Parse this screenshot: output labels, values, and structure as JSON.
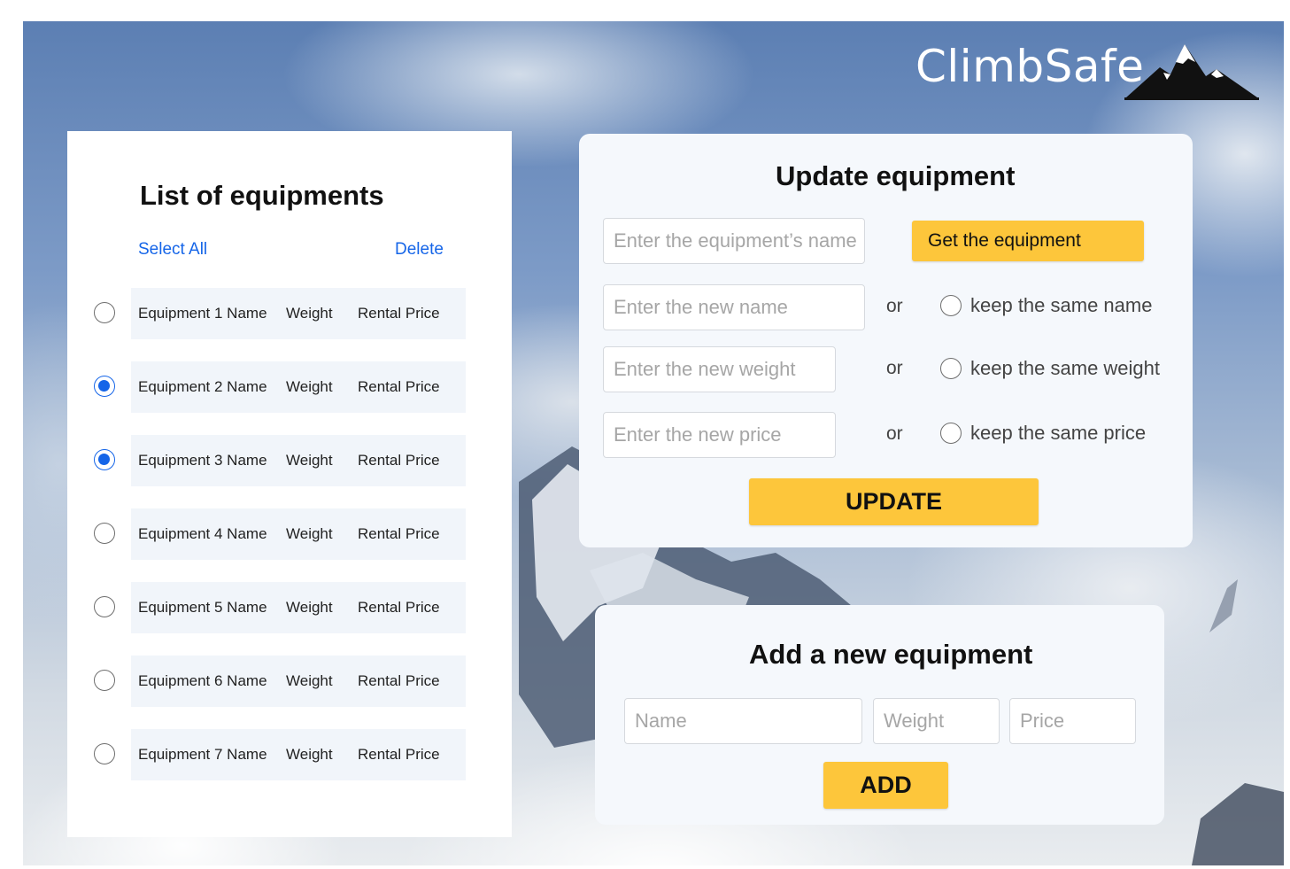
{
  "brand": {
    "name": "ClimbSafe",
    "logo_icon": "mountain-logo-icon"
  },
  "list": {
    "title": "List of equipments",
    "select_all": "Select All",
    "delete": "Delete",
    "rows": [
      {
        "name": "Equipment 1 Name",
        "weight": "Weight",
        "price": "Rental Price",
        "selected": false
      },
      {
        "name": "Equipment 2 Name",
        "weight": "Weight",
        "price": "Rental Price",
        "selected": true
      },
      {
        "name": "Equipment 3 Name",
        "weight": "Weight",
        "price": "Rental Price",
        "selected": true
      },
      {
        "name": "Equipment 4 Name",
        "weight": "Weight",
        "price": "Rental Price",
        "selected": false
      },
      {
        "name": "Equipment 5 Name",
        "weight": "Weight",
        "price": "Rental Price",
        "selected": false
      },
      {
        "name": "Equipment 6 Name",
        "weight": "Weight",
        "price": "Rental Price",
        "selected": false
      },
      {
        "name": "Equipment 7 Name",
        "weight": "Weight",
        "price": "Rental Price",
        "selected": false
      }
    ]
  },
  "update": {
    "title": "Update equipment",
    "search_placeholder": "Enter the equipment’s name",
    "get_button": "Get the equipment",
    "new_name_placeholder": "Enter the new name",
    "new_weight_placeholder": "Enter the new weight",
    "new_price_placeholder": "Enter the new price",
    "or": "or",
    "keep_name": "keep the same name",
    "keep_weight": "keep the same weight",
    "keep_price": "keep the same price",
    "update_button": "UPDATE"
  },
  "add": {
    "title": "Add a new equipment",
    "name_placeholder": "Name",
    "weight_placeholder": "Weight",
    "price_placeholder": "Price",
    "add_button": "ADD"
  },
  "colors": {
    "accent_blue": "#1565e8",
    "button_yellow": "#fdc63b"
  }
}
